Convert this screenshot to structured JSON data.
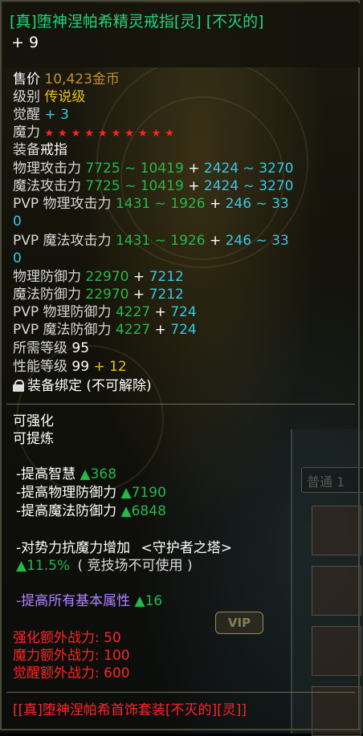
{
  "item": {
    "title": "[真]堕神涅帕希精灵戒指[灵] [不灭的]",
    "enhance": "+ 9"
  },
  "basic": {
    "price_label": "售价",
    "price_value": "10,423金币",
    "grade_label": "级别",
    "grade_value": "传说级",
    "awaken_label": "觉醒",
    "awaken_value": "+ 3",
    "magic_label": "魔力",
    "magic_stars": "★★★★★★★★★★",
    "equip_label": "装备",
    "equip_value": "戒指"
  },
  "stats": {
    "phys_atk_label": "物理攻击力",
    "phys_atk_base": "7725 ~ 10419",
    "phys_atk_plus": "+ ",
    "phys_atk_bonus": "2424 ~ 3270",
    "mag_atk_label": "魔法攻击力",
    "mag_atk_base": "7725 ~ 10419",
    "mag_atk_plus": "+ ",
    "mag_atk_bonus": "2424 ~ 3270",
    "pvp_phys_atk_label": "PVP 物理攻击力",
    "pvp_phys_atk_base": "1431 ~ 1926",
    "pvp_phys_atk_plus": "+ ",
    "pvp_phys_atk_bonus": "246 ~ 33",
    "pvp_phys_atk_wrap": "0",
    "pvp_mag_atk_label": "PVP 魔法攻击力",
    "pvp_mag_atk_base": "1431 ~ 1926",
    "pvp_mag_atk_plus": "+ ",
    "pvp_mag_atk_bonus": "246 ~ 33",
    "pvp_mag_atk_wrap": "0",
    "phys_def_label": "物理防御力",
    "phys_def_base": "22970",
    "phys_def_plus": "+ ",
    "phys_def_bonus": "7212",
    "mag_def_label": "魔法防御力",
    "mag_def_base": "22970",
    "mag_def_plus": "+ ",
    "mag_def_bonus": "7212",
    "pvp_phys_def_label": "PVP 物理防御力",
    "pvp_phys_def_base": "4227",
    "pvp_phys_def_plus": "+ ",
    "pvp_phys_def_bonus": "724",
    "pvp_mag_def_label": "PVP 魔法防御力",
    "pvp_mag_def_base": "4227",
    "pvp_mag_def_plus": "+ ",
    "pvp_mag_def_bonus": "724",
    "req_level_label": "所需等级",
    "req_level_value": "95",
    "perf_level_label": "性能等级",
    "perf_level_value": "99",
    "perf_level_bonus": "+ 12",
    "bind_text": "装备绑定 (不可解除)"
  },
  "enhance": {
    "can_enhance": "可强化",
    "can_refine": "可提炼"
  },
  "bonuses": {
    "intel_label": "-提高智慧",
    "intel_value": "▲368",
    "phys_def_label": "-提高物理防御力",
    "phys_def_value": "▲7190",
    "mag_def_label": "-提高魔法防御力",
    "mag_def_value": "▲6848",
    "resist_label": "-对势力抗魔力增加",
    "resist_tag": "<守护者之塔>",
    "resist_value": "▲11.5%",
    "resist_note": "( 竞技场不可使用 )",
    "all_attr_label": "-提高所有基本属性",
    "all_attr_value": "▲16"
  },
  "power": {
    "enhance_label": "强化额外战力:",
    "enhance_value": "50",
    "magic_label": "魔力额外战力:",
    "magic_value": "100",
    "awaken_label": "觉醒额外战力:",
    "awaken_value": "600"
  },
  "set": {
    "name": "[[真]堕神涅帕希首饰套装[不灭的][灵]]"
  },
  "background": {
    "tab_label": "普通 1",
    "vip_label": "VIP"
  },
  "colors": {
    "title": "#1fd67b",
    "green": "#25b84a",
    "cyan": "#34c9e6",
    "gold": "#c58e2e",
    "red": "#ff2424"
  }
}
